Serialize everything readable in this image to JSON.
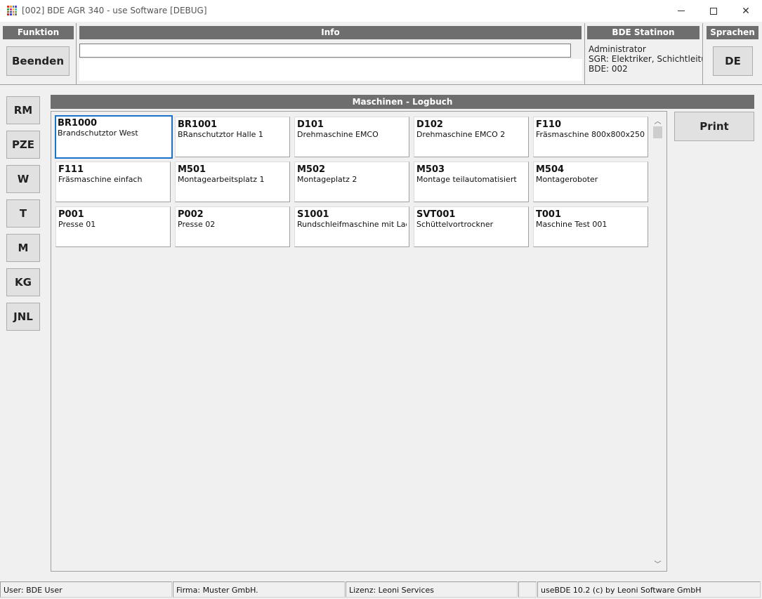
{
  "window": {
    "title": "[002] BDE AGR 340 - use Software [DEBUG]",
    "minimize": "—",
    "maximize": "□",
    "close": "✕"
  },
  "funktion": {
    "header": "Funktion",
    "beenden_label": "Beenden"
  },
  "info": {
    "header": "Info",
    "input_value": ""
  },
  "station": {
    "header": "BDE Statinon",
    "lines": [
      "Administrator",
      "SGR: Elektriker, Schichtleitun",
      "BDE: 002"
    ]
  },
  "sprachen": {
    "header": "Sprachen",
    "lang_label": "DE"
  },
  "side_nav": [
    "RM",
    "PZE",
    "W",
    "T",
    "M",
    "KG",
    "JNL"
  ],
  "logbuch": {
    "header": "Maschinen - Logbuch",
    "print_label": "Print",
    "machines": [
      {
        "code": "BR1000",
        "name": "Brandschutztor West",
        "selected": true
      },
      {
        "code": "BR1001",
        "name": "BRanschutztor Halle 1"
      },
      {
        "code": "D101",
        "name": "Drehmaschine EMCO"
      },
      {
        "code": "D102",
        "name": "Drehmaschine EMCO 2"
      },
      {
        "code": "F110",
        "name": "Fräsmaschine 800x800x250"
      },
      {
        "code": "F111",
        "name": "Fräsmaschine einfach"
      },
      {
        "code": "M501",
        "name": "Montagearbeitsplatz 1"
      },
      {
        "code": "M502",
        "name": "Montageplatz 2"
      },
      {
        "code": "M503",
        "name": "Montage teilautomatisiert"
      },
      {
        "code": "M504",
        "name": "Montageroboter"
      },
      {
        "code": "P001",
        "name": "Presse 01"
      },
      {
        "code": "P002",
        "name": "Presse 02"
      },
      {
        "code": "S1001",
        "name": "Rundschleifmaschine mit Lad"
      },
      {
        "code": "SVT001",
        "name": "Schüttelvortrockner"
      },
      {
        "code": "T001",
        "name": "Maschine Test 001"
      }
    ]
  },
  "status": {
    "user": "User: BDE User",
    "firma": "Firma: Muster GmbH.",
    "lizenz": "Lizenz: Leoni Services",
    "empty": "",
    "version": "useBDE 10.2 (c) by Leoni Software GmbH"
  },
  "colors": {
    "header_bg": "#6e6e6e",
    "selection": "#1a73c8",
    "button_bg": "#e1e1e1"
  }
}
